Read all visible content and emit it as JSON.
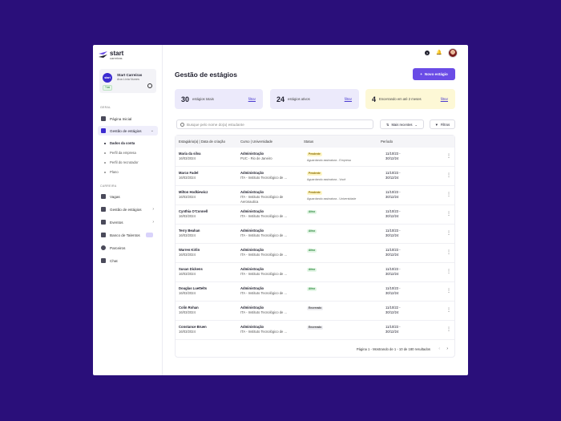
{
  "brand": {
    "title": "start",
    "subtitle": "carreiras"
  },
  "company": {
    "avatar": "start",
    "name": "Start Carreiras",
    "user": "Ana Lívia Nunes",
    "plan": "Trial"
  },
  "sidebar": {
    "section_general": "GERAL",
    "section_career": "CARREIRA",
    "general_items": [
      {
        "label": "Página Inicial",
        "icon": "home-icon"
      },
      {
        "label": "Gestão de estágios",
        "icon": "document-icon",
        "active": true
      }
    ],
    "sub_items": [
      {
        "label": "Dados da conta",
        "active": true
      },
      {
        "label": "Perfil da empresa"
      },
      {
        "label": "Perfil do recrutador"
      },
      {
        "label": "Plano"
      }
    ],
    "career_items": [
      {
        "label": "Vagas",
        "icon": "briefcase-icon"
      },
      {
        "label": "Gestão de estágios",
        "icon": "document-icon"
      },
      {
        "label": "Eventos",
        "icon": "calendar-icon"
      },
      {
        "label": "Banco de Talentos",
        "icon": "people-icon"
      },
      {
        "label": "Parceiros",
        "icon": "globe-icon"
      },
      {
        "label": "Chat",
        "icon": "chat-icon"
      }
    ]
  },
  "header": {
    "title": "Gestão de estágios",
    "new_button": "Novo estágio"
  },
  "stats": [
    {
      "number": "30",
      "label": "estágios totais",
      "filter": "filtrar"
    },
    {
      "number": "24",
      "label": "estágios ativos",
      "filter": "filtrar"
    },
    {
      "number": "4",
      "label": "Encerrando em até 2 meses",
      "filter": "filtrar"
    }
  ],
  "search": {
    "placeholder": "Busque pelo nome do(a) estudante"
  },
  "sort": {
    "label": "Mais recentes"
  },
  "filters": {
    "label": "Filtros"
  },
  "table": {
    "headers": [
      "Estagiário(a) | Data de criação",
      "Curso | Universidade",
      "Status",
      "Período"
    ],
    "rows": [
      {
        "name": "Maria da silva",
        "date": "16/03/2024",
        "course": "Administração",
        "uni": "PUC - Rio de Janeiro",
        "status": "Pendente",
        "status_class": "pendente",
        "note": "Aguardando assinatura - Empresa",
        "start": "11/10/23 -",
        "end": "30/12/24"
      },
      {
        "name": "Marco Fadel",
        "date": "16/03/2024",
        "course": "Administração",
        "uni": "ITA - Instituto Tecnológico de ...",
        "status": "Pendente",
        "status_class": "pendente",
        "note": "Aguardando assinatura - Você",
        "start": "11/10/23 -",
        "end": "30/12/24"
      },
      {
        "name": "Milton Hodkiewicz",
        "date": "16/03/2024",
        "course": "Administração",
        "uni": "ITA - Instituto Tecnológico de Aeronautica",
        "status": "Pendente",
        "status_class": "pendente",
        "note": "Aguardando assinatura - Universidade",
        "start": "11/10/23 -",
        "end": "30/12/24"
      },
      {
        "name": "Cynthia O'Connell",
        "date": "16/03/2024",
        "course": "Administração",
        "uni": "ITA - Instituto Tecnológico de ...",
        "status": "Ativo",
        "status_class": "ativo",
        "note": "",
        "start": "11/10/23 -",
        "end": "30/12/24"
      },
      {
        "name": "Terry Beahan",
        "date": "16/03/2024",
        "course": "Administração",
        "uni": "ITA - Instituto Tecnológico de ...",
        "status": "Ativo",
        "status_class": "ativo",
        "note": "",
        "start": "11/10/23 -",
        "end": "30/12/24"
      },
      {
        "name": "Warren Kirlin",
        "date": "16/03/2024",
        "course": "Administração",
        "uni": "ITA - Instituto Tecnológico de ...",
        "status": "Ativo",
        "status_class": "ativo",
        "note": "",
        "start": "11/10/23 -",
        "end": "30/12/24"
      },
      {
        "name": "Susan Dickens",
        "date": "16/03/2024",
        "course": "Administração",
        "uni": "ITA - Instituto Tecnológico de ...",
        "status": "Ativo",
        "status_class": "ativo",
        "note": "",
        "start": "11/10/23 -",
        "end": "30/12/24"
      },
      {
        "name": "Douglas Luettelts",
        "date": "16/03/2024",
        "course": "Administração",
        "uni": "ITA - Instituto Tecnológico de ...",
        "status": "Ativo",
        "status_class": "ativo",
        "note": "",
        "start": "11/10/23 -",
        "end": "30/12/24"
      },
      {
        "name": "Colin Rohan",
        "date": "16/03/2024",
        "course": "Administração",
        "uni": "ITA - Instituto Tecnológico de ...",
        "status": "Encerrado",
        "status_class": "encerrado",
        "note": "",
        "start": "11/10/22 -",
        "end": "30/12/24"
      },
      {
        "name": "Constance Bruen",
        "date": "16/03/2024",
        "course": "Administração",
        "uni": "ITA - Instituto Tecnológico de ...",
        "status": "Encerrado",
        "status_class": "encerrado",
        "note": "",
        "start": "11/10/23 -",
        "end": "30/12/24"
      }
    ]
  },
  "pagination": {
    "text": "Página 1 - Mostrando de 1 - 10 de 180 resultados"
  },
  "colors": {
    "accent": "#6a4ce6",
    "background": "#2a0f7a"
  }
}
